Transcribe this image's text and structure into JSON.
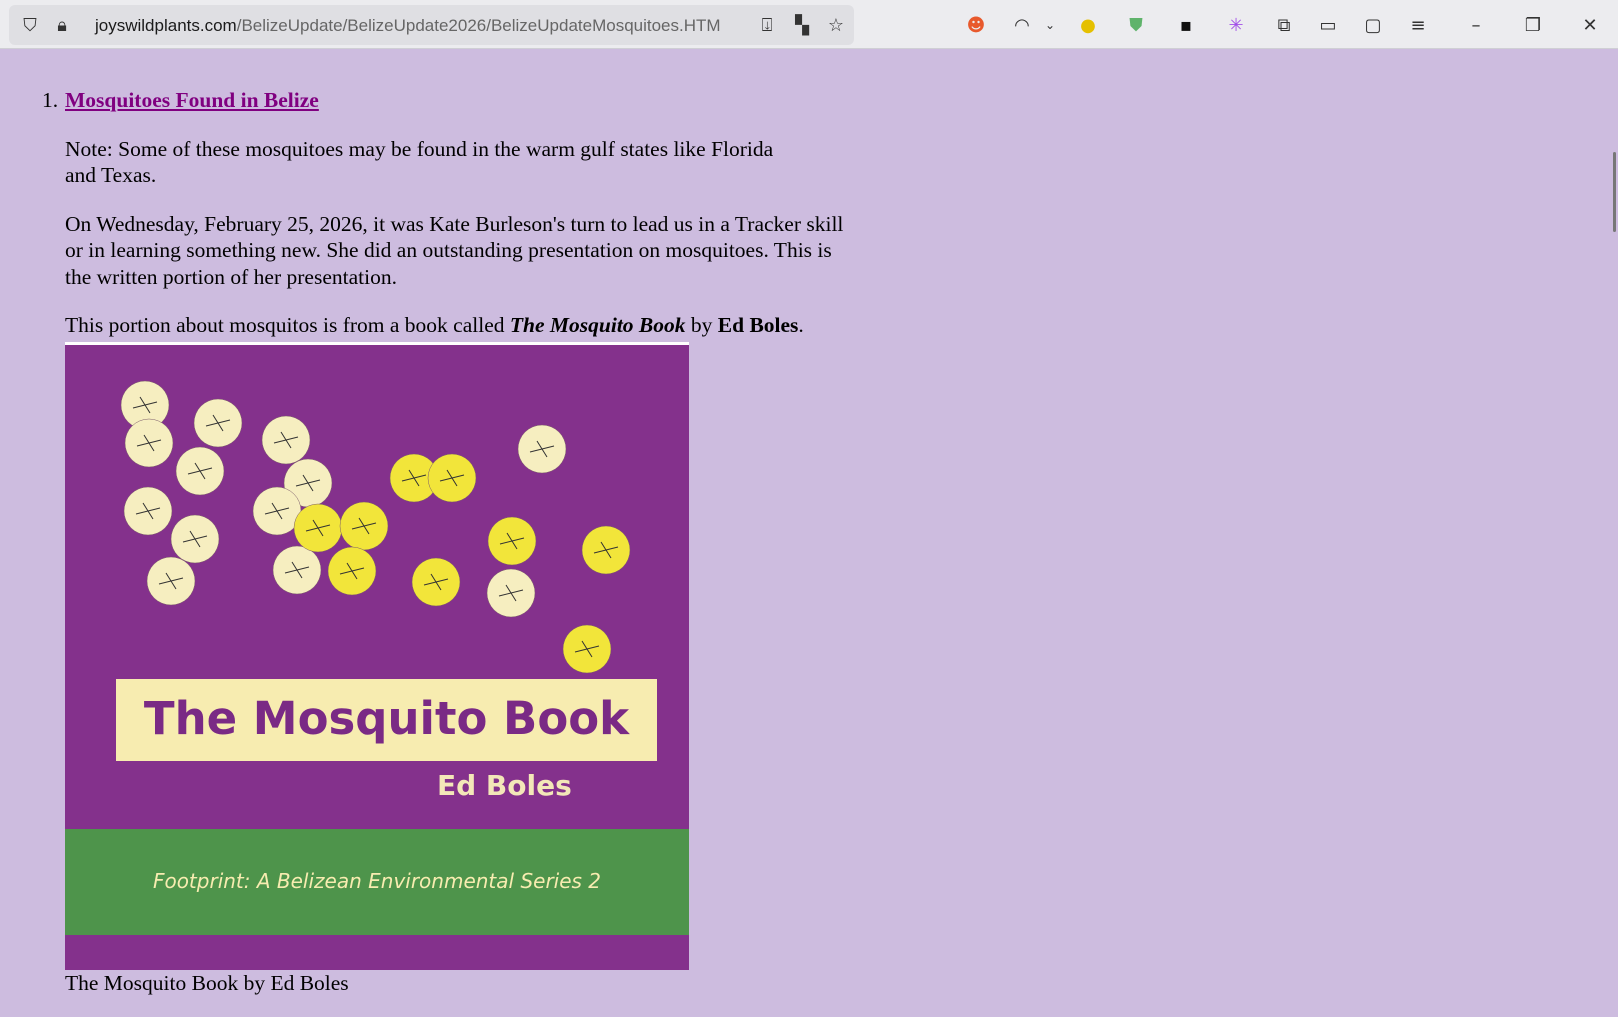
{
  "browser": {
    "url_host": "joyswildplants.com",
    "url_path": "/BelizeUpdate/BelizeUpdate2026/BelizeUpdateMosquitoes.HTM"
  },
  "article": {
    "item_number": "1.",
    "heading": "Mosquitoes Found in Belize",
    "note": "Note: Some of these mosquitoes may be found in the warm gulf states like Florida and Texas.",
    "intro": "On Wednesday, February 25, 2026, it was Kate Burleson's turn to lead us in a Tracker skill or in learning something new.  She did an outstanding presentation on mosquitoes.  This is the written portion of her presentation.",
    "source_prefix": "This portion about mosquitos is from a book called ",
    "book_title": "The Mosquito Book",
    "source_by": " by ",
    "author": "Ed Boles",
    "source_end": ".",
    "cover": {
      "title": "The Mosquito Book",
      "author": "Ed Boles",
      "series": "Footprint: A Belizean Environmental Series 2"
    },
    "caption": "The Mosquito Book by Ed Boles"
  }
}
